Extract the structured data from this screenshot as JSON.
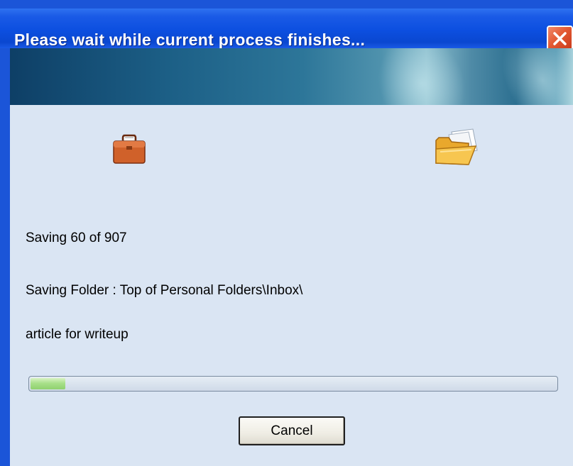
{
  "window": {
    "title": "Please wait while current process finishes...",
    "close_icon": "close-icon",
    "colors": {
      "titlebar": "#0c4fe0",
      "close_button": "#e35a33",
      "body": "#dae5f3",
      "progress_fill": "#a9e08a"
    }
  },
  "icons": {
    "source": "briefcase-icon",
    "destination": "open-folder-icon"
  },
  "status": {
    "count_text": "Saving 60 of 907",
    "folder_text": "Saving Folder : Top of Personal Folders\\Inbox\\",
    "item_text": "article for writeup"
  },
  "progress": {
    "fraction": 0.066
  },
  "buttons": {
    "cancel_label": "Cancel"
  }
}
